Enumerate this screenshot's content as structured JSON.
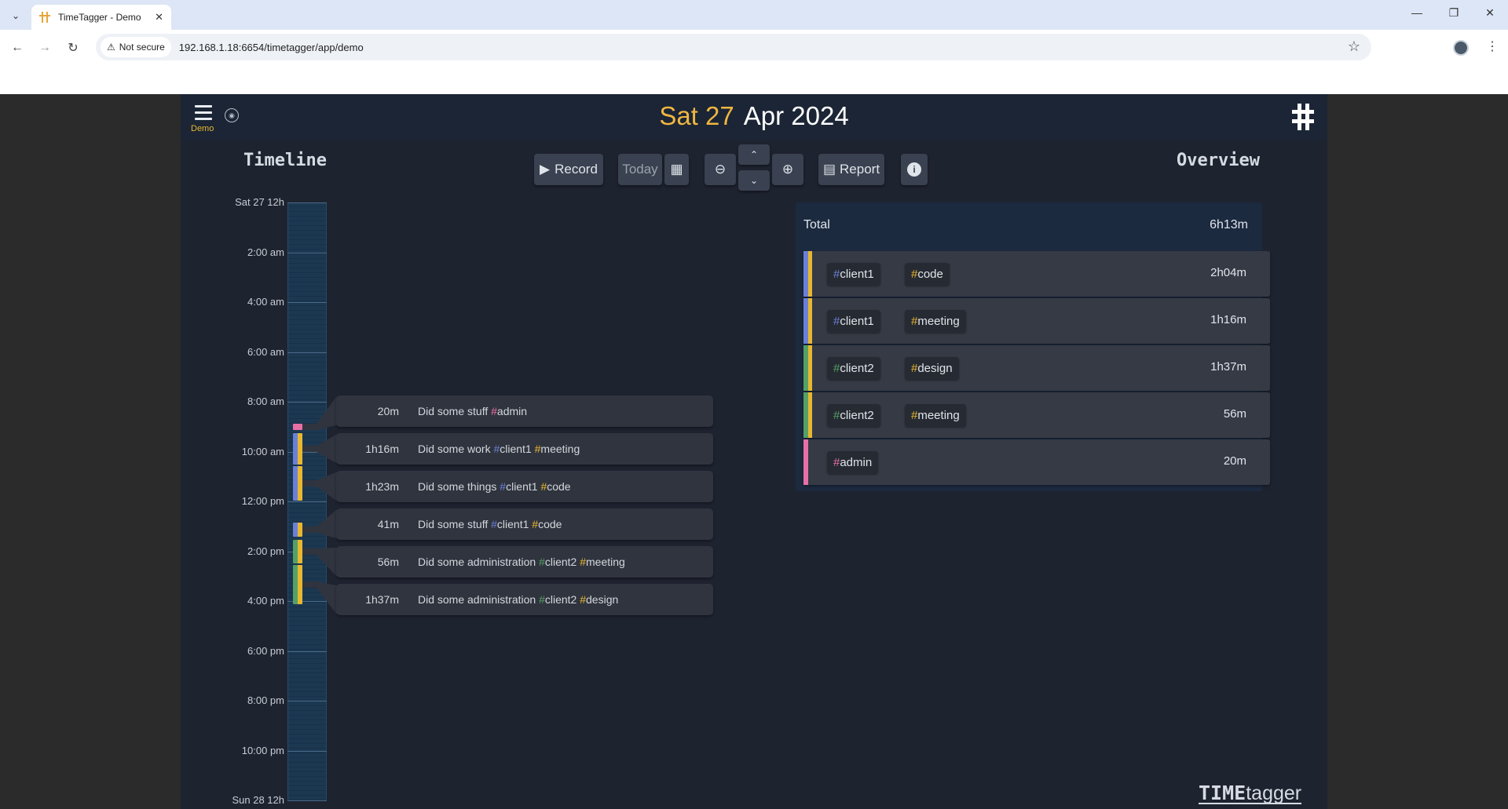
{
  "browser": {
    "tab_title": "TimeTagger - Demo",
    "security_label": "Not secure",
    "url": "192.168.1.18:6654/timetagger/app/demo"
  },
  "header": {
    "menu_label": "Demo",
    "day": "Sat 27",
    "month_year": "Apr 2024"
  },
  "toolbar": {
    "record_label": "Record",
    "today_label": "Today",
    "report_label": "Report"
  },
  "sections": {
    "timeline": "Timeline",
    "overview": "Overview"
  },
  "timeline": {
    "ticks": [
      "Sat 27  12h",
      "2:00 am",
      "4:00 am",
      "6:00 am",
      "8:00 am",
      "10:00 am",
      "12:00 pm",
      "2:00 pm",
      "4:00 pm",
      "6:00 pm",
      "8:00 pm",
      "10:00 pm",
      "Sun 28  12h"
    ],
    "records": [
      {
        "duration": "20m",
        "text": "Did some stuff ",
        "tags": [
          {
            "name": "admin",
            "color": "#e86fa6"
          }
        ]
      },
      {
        "duration": "1h16m",
        "text": "Did some work ",
        "tags": [
          {
            "name": "client1",
            "color": "#6a80d8"
          },
          {
            "name": "meeting",
            "color": "#e8b730"
          }
        ]
      },
      {
        "duration": "1h23m",
        "text": "Did some things ",
        "tags": [
          {
            "name": "client1",
            "color": "#6a80d8"
          },
          {
            "name": "code",
            "color": "#e8b730"
          }
        ]
      },
      {
        "duration": "41m",
        "text": "Did some stuff ",
        "tags": [
          {
            "name": "client1",
            "color": "#6a80d8"
          },
          {
            "name": "code",
            "color": "#e8b730"
          }
        ]
      },
      {
        "duration": "56m",
        "text": "Did some administration ",
        "tags": [
          {
            "name": "client2",
            "color": "#55a066"
          },
          {
            "name": "meeting",
            "color": "#e8b730"
          }
        ]
      },
      {
        "duration": "1h37m",
        "text": "Did some administration ",
        "tags": [
          {
            "name": "client2",
            "color": "#55a066"
          },
          {
            "name": "design",
            "color": "#e8b730"
          }
        ]
      }
    ]
  },
  "overview": {
    "total_label": "Total",
    "total_value": "6h13m",
    "rows": [
      {
        "tags": [
          {
            "name": "client1",
            "color": "#6a80d8"
          },
          {
            "name": "code",
            "color": "#e8b730"
          }
        ],
        "value": "2h04m"
      },
      {
        "tags": [
          {
            "name": "client1",
            "color": "#6a80d8"
          },
          {
            "name": "meeting",
            "color": "#e8b730"
          }
        ],
        "value": "1h16m"
      },
      {
        "tags": [
          {
            "name": "client2",
            "color": "#55a066"
          },
          {
            "name": "design",
            "color": "#e8b730"
          }
        ],
        "value": "1h37m"
      },
      {
        "tags": [
          {
            "name": "client2",
            "color": "#55a066"
          },
          {
            "name": "meeting",
            "color": "#e8b730"
          }
        ],
        "value": "56m"
      },
      {
        "tags": [
          {
            "name": "admin",
            "color": "#e86fa6"
          }
        ],
        "value": "20m"
      }
    ]
  },
  "brand": {
    "part1": "TIME",
    "part2": "tagger"
  },
  "colors": {
    "accent": "#f0b641",
    "client1": "#6a80d8",
    "client2": "#55a066",
    "admin": "#e86fa6",
    "tag_secondary": "#e8b730"
  }
}
